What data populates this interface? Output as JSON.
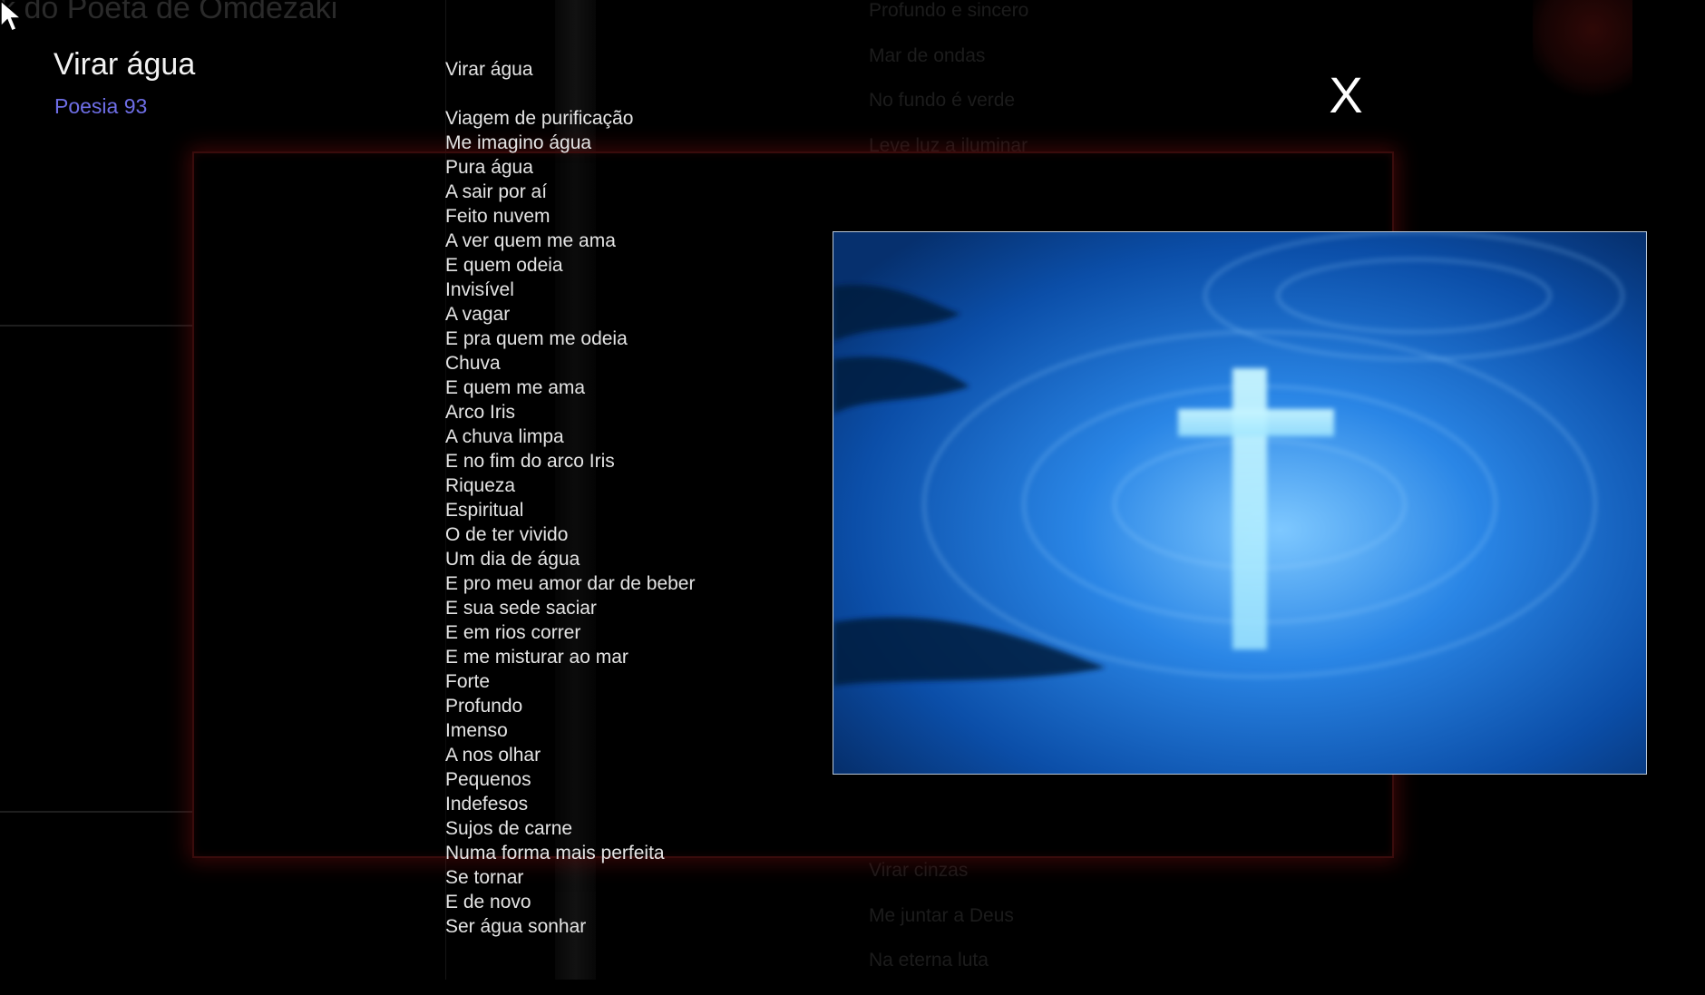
{
  "window": {
    "background_title": "k do Poeta de Omdezaki",
    "background_lines_top": [
      "Profundo e sincero",
      "Mar de ondas",
      "No fundo é verde",
      "Leve luz a iluminar"
    ],
    "background_lines_bottom": [
      "Virar cinzas",
      "Me juntar a Deus",
      "Na eterna luta"
    ]
  },
  "poem": {
    "title": "Virar água",
    "subtitle": "Poesia 93",
    "heading": "Virar água",
    "lines": [
      "Viagem de purificação",
      "Me imagino água",
      "Pura água",
      "A sair por aí",
      "Feito nuvem",
      "A ver quem me ama",
      "E quem odeia",
      "Invisível",
      "A vagar",
      "E pra quem me odeia",
      "Chuva",
      "E quem me ama",
      "Arco Iris",
      "A chuva limpa",
      "E no fim do arco Iris",
      "Riqueza",
      "Espiritual",
      "O de ter vivido",
      "Um dia de água",
      "E pro meu amor dar de beber",
      "E sua sede saciar",
      "E em rios correr",
      "E me misturar ao mar",
      "Forte",
      "Profundo",
      "Imenso",
      "A nos olhar",
      "Pequenos",
      "Indefesos",
      "Sujos de carne",
      "Numa forma mais perfeita",
      "Se tornar",
      "E de novo",
      "Ser água sonhar"
    ]
  },
  "controls": {
    "close_label": "X"
  },
  "image": {
    "description_icon": "cross-on-water-image"
  },
  "colors": {
    "subtitle": "#6e6ee6",
    "frame_glow": "#6e0c0c",
    "water": "#0a4fa3"
  }
}
